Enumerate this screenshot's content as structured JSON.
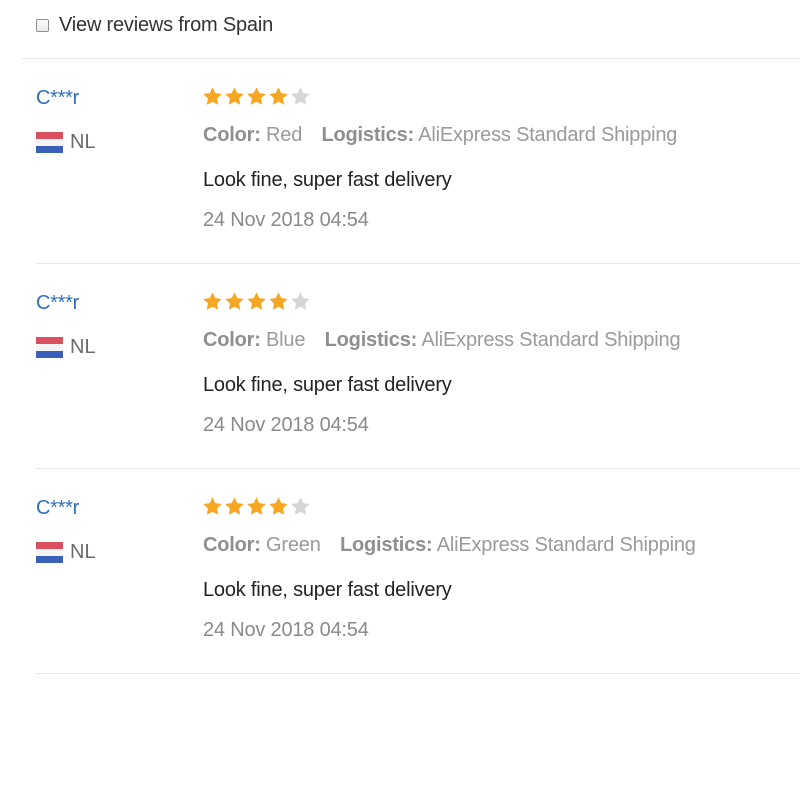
{
  "filter": {
    "label": "View reviews from Spain",
    "checked": false
  },
  "rating_color": "#f5a623",
  "rating_empty_color": "#d6d6d6",
  "reviews": [
    {
      "user": "C***r",
      "country": "NL",
      "rating": 4,
      "rating_max": 5,
      "color_label": "Color:",
      "color_value": "Red",
      "logistics_label": "Logistics:",
      "logistics_value": "AliExpress Standard Shipping",
      "feedback": "Look fine, super fast delivery",
      "date": "24 Nov 2018 04:54"
    },
    {
      "user": "C***r",
      "country": "NL",
      "rating": 4,
      "rating_max": 5,
      "color_label": "Color:",
      "color_value": "Blue",
      "logistics_label": "Logistics:",
      "logistics_value": "AliExpress Standard Shipping",
      "feedback": "Look fine, super fast delivery",
      "date": "24 Nov 2018 04:54"
    },
    {
      "user": "C***r",
      "country": "NL",
      "rating": 4,
      "rating_max": 5,
      "color_label": "Color:",
      "color_value": "Green",
      "logistics_label": "Logistics:",
      "logistics_value": "AliExpress Standard Shipping",
      "feedback": "Look fine, super fast delivery",
      "date": "24 Nov 2018 04:54"
    }
  ]
}
